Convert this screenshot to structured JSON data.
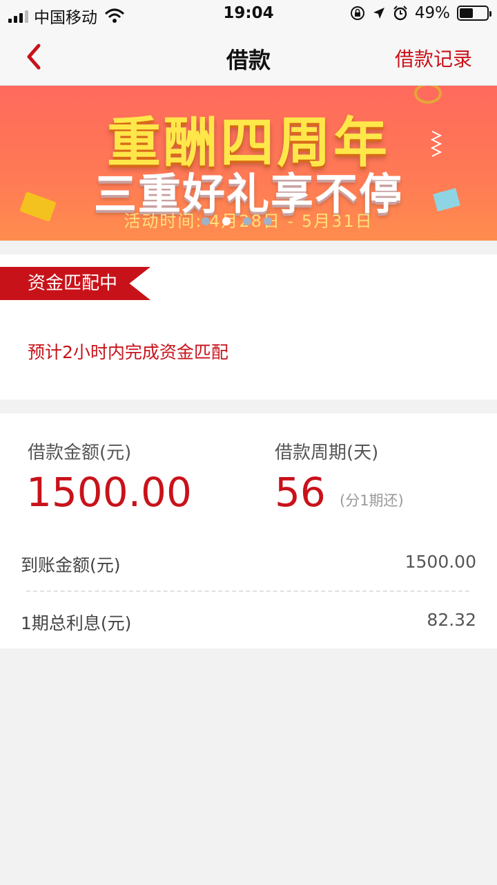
{
  "status_bar": {
    "carrier": "中国移动",
    "time": "19:04",
    "battery": "49%",
    "battery_level": 0.49
  },
  "nav": {
    "title": "借款",
    "right_link": "借款记录"
  },
  "banner": {
    "line1": "重酬四周年",
    "line2": "三重好礼享不停",
    "line3": "活动时间: 4月28日 - 5月31日",
    "dot_count": 4,
    "active_dot": 1
  },
  "status": {
    "tag": "资金匹配中",
    "note": "预计2小时内完成资金匹配"
  },
  "loan": {
    "amount_label": "借款金额(元)",
    "amount": "1500.00",
    "period_label": "借款周期(天)",
    "period": "56",
    "period_note": "(分1期还)",
    "received_label": "到账金额(元)",
    "received": "1500.00",
    "interest_label": "1期总利息(元)",
    "interest": "82.32"
  },
  "colors": {
    "accent": "#c8121a",
    "banner_bg": "#ff6a5c",
    "page_bg": "#f2f2f2"
  }
}
